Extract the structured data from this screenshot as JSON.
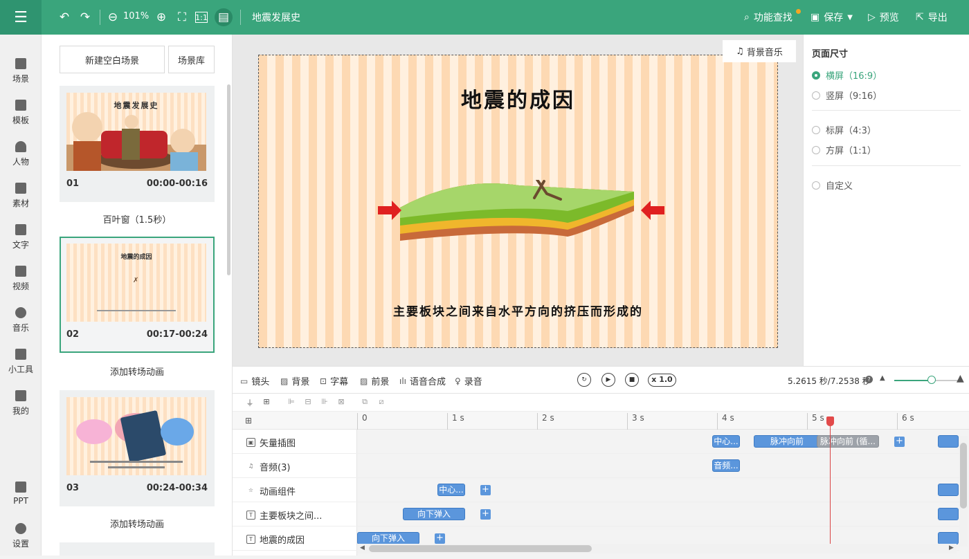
{
  "toolbar": {
    "zoom": "101%",
    "doc_title": "地震发展史",
    "search_label": "功能查找",
    "save_label": "保存",
    "preview_label": "预览",
    "export_label": "导出",
    "accent_color": "#3aa57c"
  },
  "nav": {
    "items": [
      "场景",
      "模板",
      "人物",
      "素材",
      "文字",
      "视频",
      "音乐",
      "小工具",
      "我的",
      "PPT",
      "设置"
    ]
  },
  "scenes": {
    "new_blank": "新建空白场景",
    "library": "场景库",
    "items": [
      {
        "num": "01",
        "time": "00:00-00:16",
        "thumb_title": "地震发展史",
        "transition": "百叶窗（1.5秒）"
      },
      {
        "num": "02",
        "time": "00:17-00:24",
        "thumb_title": "地震的成因",
        "transition": "添加转场动画"
      },
      {
        "num": "03",
        "time": "00:24-00:34",
        "thumb_title": "",
        "transition": "添加转场动画"
      }
    ]
  },
  "canvas": {
    "bgm_label": "背景音乐",
    "title": "地震的成因",
    "subtitle": "主要板块之间来自水平方向的挤压而形成的"
  },
  "page_size": {
    "title": "页面尺寸",
    "options": [
      {
        "label": "横屏（16:9）",
        "selected": true
      },
      {
        "label": "竖屏（9:16）",
        "selected": false
      },
      {
        "label": "标屏（4:3）",
        "selected": false
      },
      {
        "label": "方屏（1:1）",
        "selected": false
      },
      {
        "label": "自定义",
        "selected": false
      }
    ]
  },
  "timeline": {
    "tabs": [
      "镜头",
      "背景",
      "字幕",
      "前景",
      "语音合成",
      "录音"
    ],
    "speed": "x 1.0",
    "time_readout": "5.2615 秒/7.2538 秒",
    "ticks": [
      "0",
      "1 s",
      "2 s",
      "3 s",
      "4 s",
      "5 s",
      "6 s"
    ],
    "tracks": [
      {
        "label": "矢量插图",
        "clips": [
          "中心...",
          "脉冲向前",
          "脉冲向前 (循..."
        ]
      },
      {
        "label": "音频(3)",
        "clips": [
          "音频..."
        ]
      },
      {
        "label": "动画组件",
        "clips": [
          "中心..."
        ]
      },
      {
        "label": "主要板块之间...",
        "clips": [
          "向下弹入"
        ]
      },
      {
        "label": "地震的成因",
        "clips": [
          "向下弹入"
        ]
      }
    ],
    "playhead_seconds": 5.2615,
    "total_seconds": 7.2538
  }
}
